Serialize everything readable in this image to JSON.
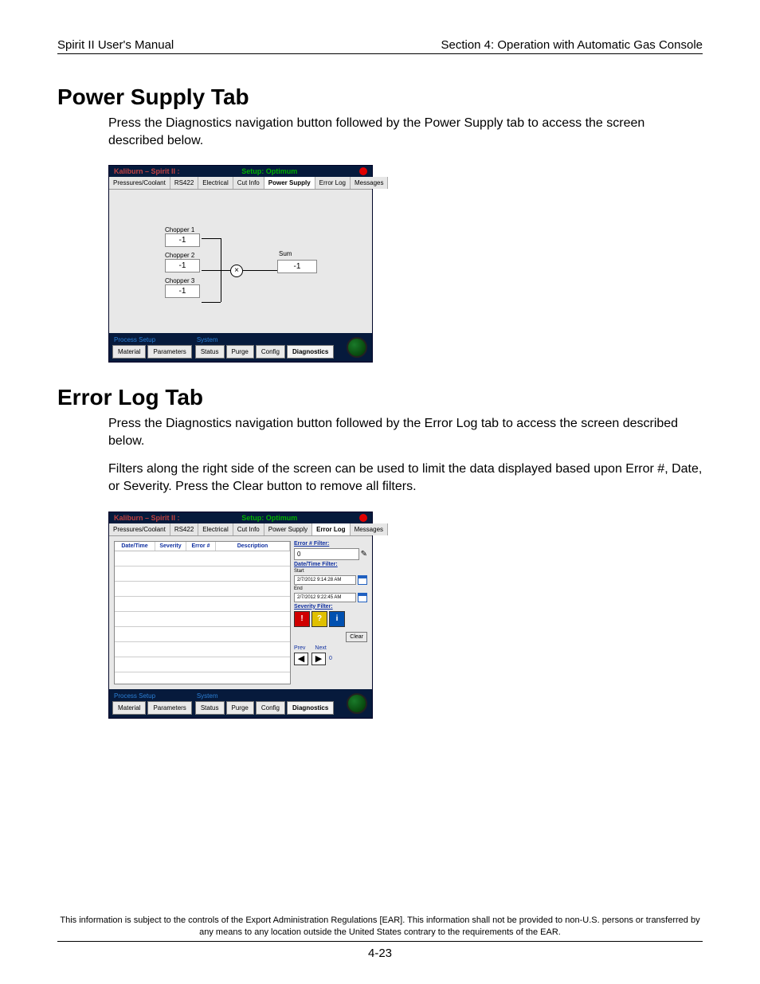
{
  "header": {
    "left": "Spirit II User's Manual",
    "right": "Section 4: Operation with Automatic Gas Console"
  },
  "sections": {
    "power": {
      "title": "Power Supply Tab",
      "body": "Press the Diagnostics navigation button followed by the Power Supply tab to access the screen described below."
    },
    "errorlog": {
      "title": "Error Log Tab",
      "body1": "Press the Diagnostics navigation button followed by the Error Log tab to access the screen described below.",
      "body2": "Filters along the right side of the screen can be used to limit the data displayed based upon Error #, Date, or Severity.  Press the Clear button to remove all filters."
    }
  },
  "app": {
    "title_prefix": "Kaliburn – Spirit II :",
    "title_mode": "Setup: Optimum",
    "tabs": {
      "pressures": "Pressures/Coolant",
      "rs422": "RS422",
      "electrical": "Electrical",
      "cutinfo": "Cut Info",
      "powersupply": "Power Supply",
      "errorlog": "Error Log",
      "messages": "Messages"
    },
    "power_supply": {
      "chopper1_label": "Chopper 1",
      "chopper1_val": "-1",
      "chopper2_label": "Chopper 2",
      "chopper2_val": "-1",
      "chopper3_label": "Chopper 3",
      "chopper3_val": "-1",
      "sum_label": "Sum",
      "sum_val": "-1"
    },
    "error_log": {
      "cols": {
        "date": "Date/Time",
        "severity": "Severity",
        "error": "Error #",
        "desc": "Description"
      },
      "filters": {
        "error_filter_label": "Error # Filter:",
        "error_filter_val": "0",
        "date_filter_label": "Date/Time Filter:",
        "start_label": "Start",
        "start_val": "2/7/2012 9:14:28 AM",
        "end_label": "End",
        "end_val": "2/7/2012 9:22:45 AM",
        "severity_label": "Severity Filter:",
        "clear_btn": "Clear",
        "prev": "Prev",
        "next": "Next",
        "count": "0"
      }
    },
    "footer": {
      "group1_label": "Process Setup",
      "material": "Material",
      "parameters": "Parameters",
      "group2_label": "System",
      "status": "Status",
      "purge": "Purge",
      "config": "Config",
      "diagnostics": "Diagnostics"
    }
  },
  "legal": "This information is subject to the controls of the Export Administration Regulations [EAR].  This information shall not be provided to non-U.S. persons or transferred by any means to any location outside the United States contrary to the requirements of the EAR.",
  "page_number": "4-23"
}
